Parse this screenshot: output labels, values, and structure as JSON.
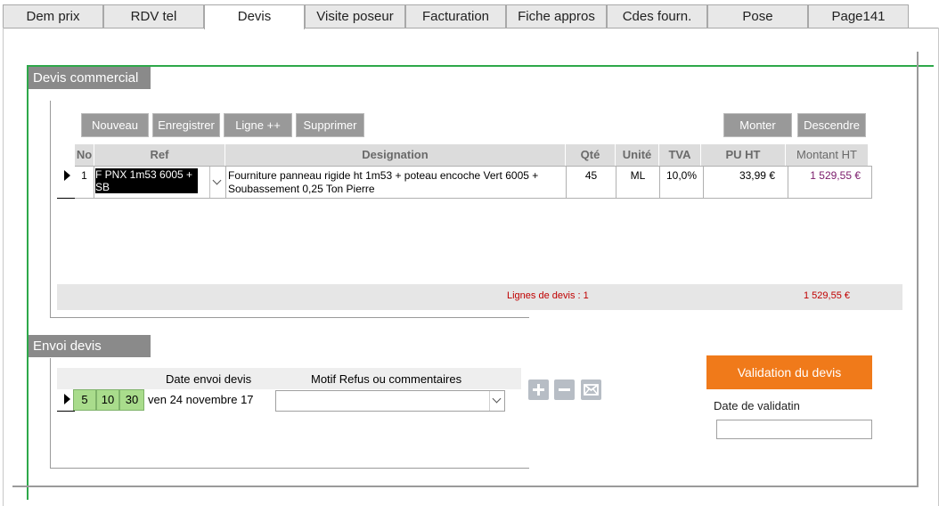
{
  "tabs": [
    {
      "label": "Dem prix",
      "active": false
    },
    {
      "label": "RDV tel",
      "active": false
    },
    {
      "label": "Devis",
      "active": true
    },
    {
      "label": "Visite poseur",
      "active": false
    },
    {
      "label": "Facturation",
      "active": false
    },
    {
      "label": "Fiche appros",
      "active": false
    },
    {
      "label": "Cdes fourn.",
      "active": false
    },
    {
      "label": "Pose",
      "active": false
    },
    {
      "label": "Page141",
      "active": false
    }
  ],
  "devis": {
    "title": "Devis commercial",
    "buttons": {
      "nouveau": "Nouveau",
      "enregistrer": "Enregistrer",
      "ligne": "Ligne ++",
      "supprimer": "Supprimer",
      "monter": "Monter",
      "descendre": "Descendre"
    },
    "columns": {
      "no": "No",
      "ref": "Ref",
      "designation": "Designation",
      "qte": "Qté",
      "unite": "Unité",
      "tva": "TVA",
      "pu_ht": "PU HT",
      "montant_ht": "Montant HT"
    },
    "rows": [
      {
        "no": "1",
        "ref": "F PNX 1m53 6005 + SB",
        "designation": "Fourniture panneau rigide ht 1m53 + poteau encoche Vert 6005 + Soubassement 0,25 Ton Pierre",
        "qte": "45",
        "unite": "ML",
        "tva": "10,0%",
        "pu_ht": "33,99 €",
        "montant_ht": "1 529,55 €"
      }
    ],
    "footer": {
      "lines_label": "Lignes de devis : 1",
      "total": "1 529,55 €"
    }
  },
  "envoi": {
    "title": "Envoi devis",
    "col_date": "Date envoi devis",
    "col_motif": "Motif Refus ou commentaires",
    "chips": [
      "5",
      "10",
      "30"
    ],
    "date_value": "ven 24 novembre 17",
    "motif_value": ""
  },
  "validation": {
    "button_label": "Validation du devis",
    "date_label": "Date de validatin",
    "date_value": ""
  },
  "colors": {
    "accent_orange": "#f07a1a",
    "green_border": "#2ea84a",
    "chip_green": "#a9dc8c",
    "total_red": "#c00000",
    "montant_purple": "#7a1a6a"
  }
}
